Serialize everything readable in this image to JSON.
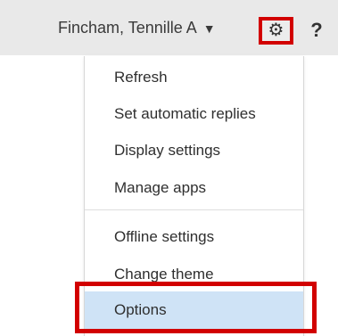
{
  "header": {
    "user_name": "Fincham, Tennille A",
    "user_caret_icon": "caret-down-icon",
    "settings_icon": "gear-icon",
    "help_label": "?"
  },
  "settings_menu": {
    "items": [
      {
        "label": "Refresh"
      },
      {
        "label": "Set automatic replies"
      },
      {
        "label": "Display settings"
      },
      {
        "label": "Manage apps"
      },
      {
        "label": "Offline settings"
      },
      {
        "label": "Change theme"
      },
      {
        "label": "Options"
      }
    ],
    "selected": "Options",
    "highlight_color": "#cfe3f6"
  },
  "annotation": {
    "highlight_border_color": "#d20000"
  }
}
